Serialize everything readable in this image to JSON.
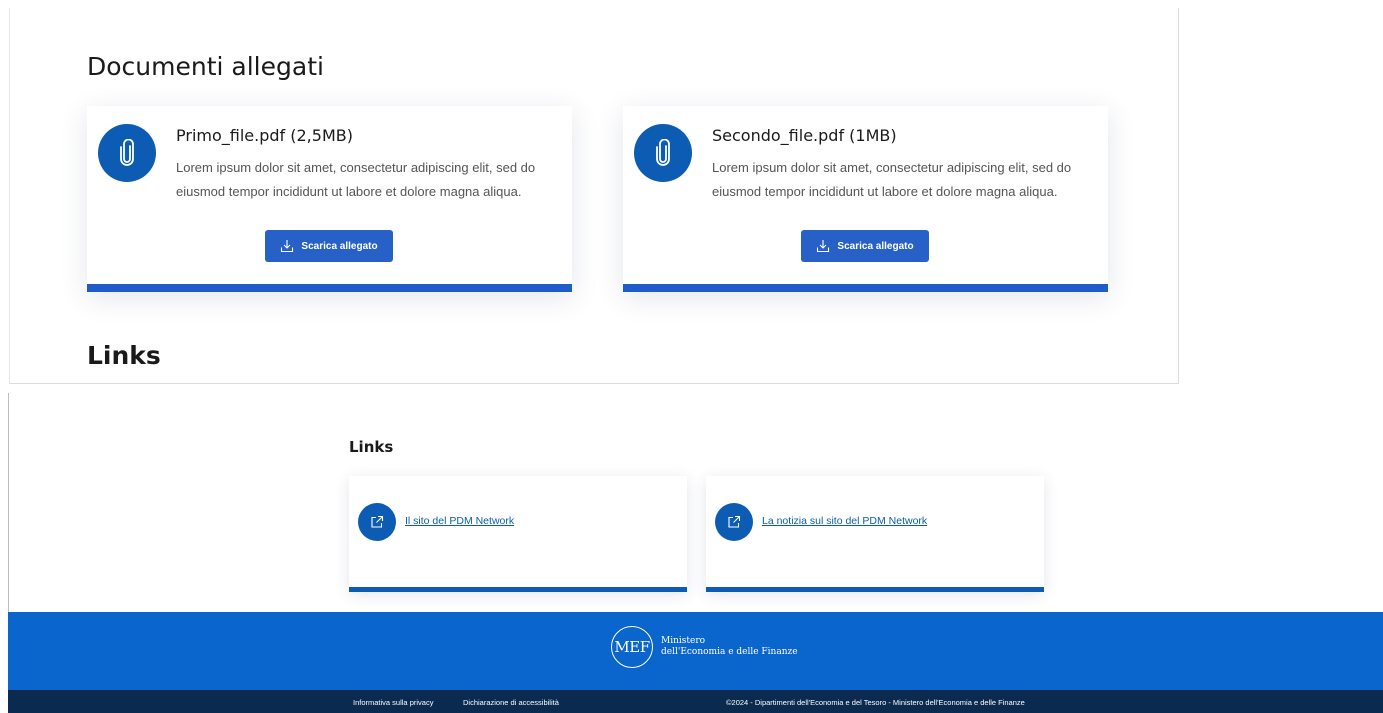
{
  "documents": {
    "heading": "Documenti allegati",
    "items": [
      {
        "title": "Primo_file.pdf (2,5MB)",
        "description": "Lorem ipsum dolor sit amet, consectetur adipiscing elit, sed do eiusmod tempor incididunt ut labore et dolore magna aliqua.",
        "button_label": "Scarica allegato",
        "icon": "paperclip-icon"
      },
      {
        "title": "Secondo_file.pdf (1MB)",
        "description": "Lorem ipsum dolor sit amet, consectetur adipiscing elit, sed do eiusmod tempor incididunt ut labore et dolore magna aliqua.",
        "button_label": "Scarica allegato",
        "icon": "paperclip-icon"
      }
    ]
  },
  "links_section_top": {
    "heading": "Links"
  },
  "links": {
    "heading": "Links",
    "items": [
      {
        "label": "Il sito del PDM Network",
        "icon": "external-link-icon"
      },
      {
        "label": "La notizia sul sito del PDM Network",
        "icon": "external-link-icon"
      }
    ]
  },
  "footer": {
    "logo_mark": "MEF",
    "logo_line1": "Ministero",
    "logo_line2": "dell'Economia e delle Finanze",
    "privacy_link": "Informativa sulla privacy",
    "accessibility_link": "Dichiarazione di accessibilità",
    "copyright": "©2024 - Dipartimenti dell'Economia e del Tesoro - Ministero dell'Economia e delle Finanze"
  },
  "colors": {
    "primary": "#0d5cb3",
    "button": "#2760c7",
    "footer_blue": "#0a66cc",
    "footer_dark": "#0b2a4f"
  }
}
